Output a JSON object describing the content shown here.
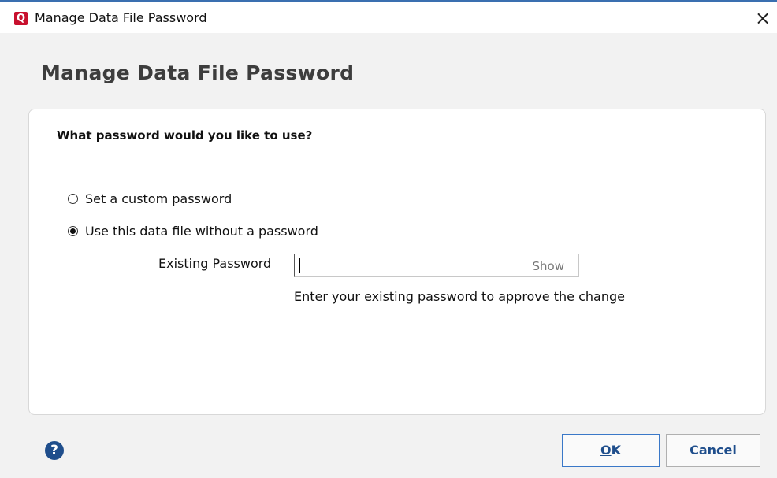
{
  "window": {
    "title": "Manage Data File Password",
    "app_icon_letter": "Q",
    "close_glyph": "×",
    "accent_color": "#c8102e"
  },
  "dialog": {
    "heading": "Manage Data File Password",
    "question": "What password would you like to use?",
    "options": [
      {
        "label": "Set a custom password",
        "selected": false
      },
      {
        "label": "Use this data file without a password",
        "selected": true
      }
    ],
    "existing_password": {
      "label": "Existing Password",
      "value": "",
      "show_label": "Show",
      "hint": "Enter your existing password to approve the change"
    }
  },
  "footer": {
    "help_glyph": "?",
    "ok_label_mnemonic": "O",
    "ok_label_rest": "K",
    "cancel_label": "Cancel"
  }
}
